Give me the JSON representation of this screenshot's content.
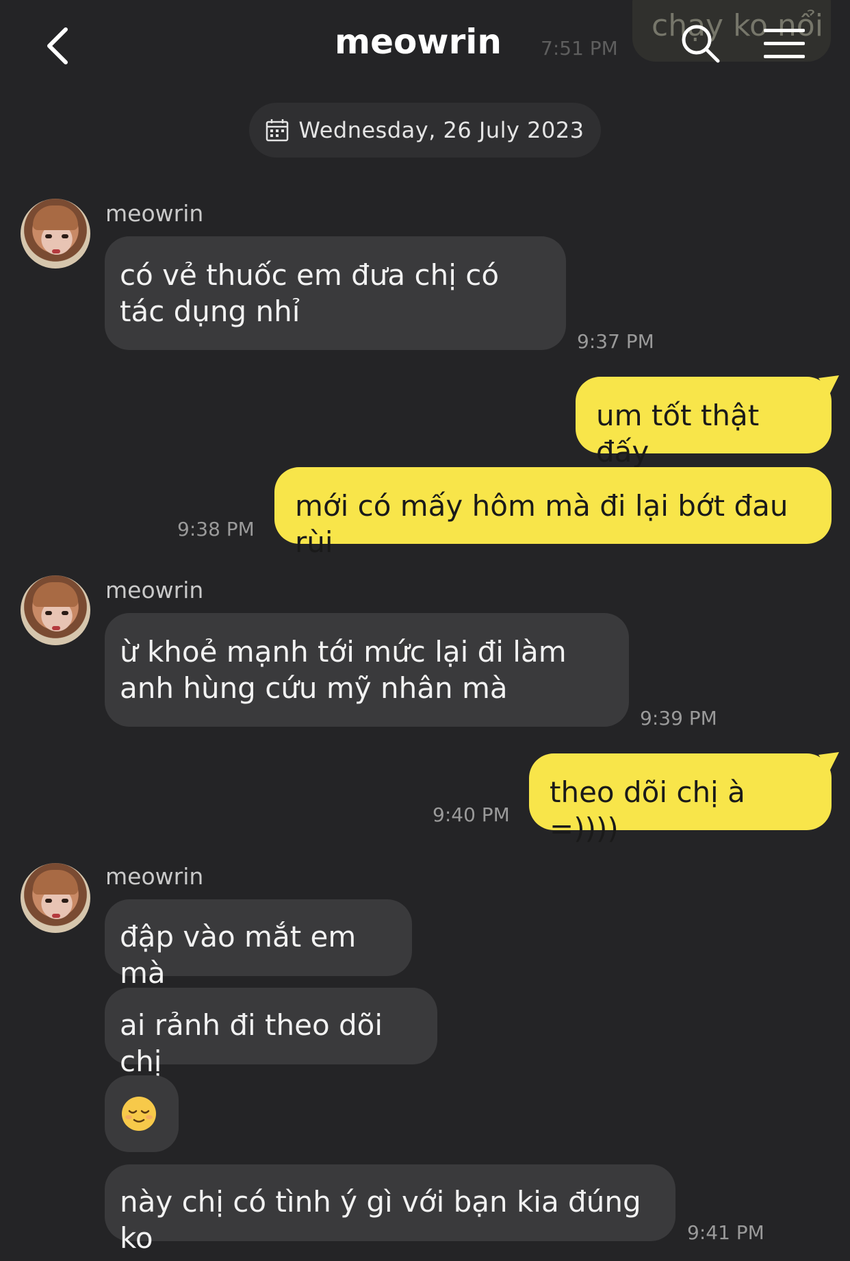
{
  "header": {
    "title": "meowrin",
    "back_icon": "chevron-left-icon",
    "search_icon": "search-icon",
    "menu_icon": "hamburger-menu-icon"
  },
  "ghost_message": {
    "text": "chạy ko nổi",
    "time": "7:51 PM"
  },
  "date_divider": {
    "icon": "calendar-icon",
    "text": "Wednesday, 26 July 2023"
  },
  "colors": {
    "background": "#242426",
    "incoming_bubble": "#3a3a3c",
    "outgoing_bubble": "#f8e54a"
  },
  "messages": [
    {
      "sender": "meowrin",
      "direction": "in",
      "text": "có vẻ thuốc em đưa chị có tác dụng nhỉ",
      "time": "9:37 PM"
    },
    {
      "direction": "out",
      "text": "um tốt thật đấy"
    },
    {
      "direction": "out",
      "text": "mới có mấy hôm mà đi lại bớt đau rùi",
      "time": "9:38 PM"
    },
    {
      "sender": "meowrin",
      "direction": "in",
      "text": "ừ khoẻ mạnh tới mức lại đi làm anh hùng cứu mỹ nhân mà",
      "time": "9:39 PM"
    },
    {
      "direction": "out",
      "text": "theo dõi chị à =))))",
      "time": "9:40 PM"
    },
    {
      "sender": "meowrin",
      "direction": "in",
      "text": "đập vào mắt em mà"
    },
    {
      "direction": "in",
      "text": "ai rảnh đi theo dõi chị"
    },
    {
      "direction": "in",
      "emoji": "relieved-face-emoji"
    },
    {
      "direction": "in",
      "text": "này chị có tình ý gì với bạn kia đúng ko",
      "time": "9:41 PM"
    }
  ]
}
